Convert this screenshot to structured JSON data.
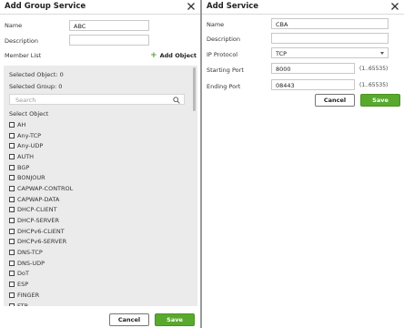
{
  "left_dialog": {
    "title": "Add Group Service",
    "name_label": "Name",
    "name_value": "ABC",
    "description_label": "Description",
    "description_value": "",
    "member_list_label": "Member List",
    "add_object_label": "Add Object",
    "selected_object": "Selected Object: 0",
    "selected_group": "Selected Group: 0",
    "search_placeholder": "Search",
    "select_object_header": "Select Object",
    "objects": [
      "AH",
      "Any-TCP",
      "Any-UDP",
      "AUTH",
      "BGP",
      "BONJOUR",
      "CAPWAP-CONTROL",
      "CAPWAP-DATA",
      "DHCP-CLIENT",
      "DHCP-SERVER",
      "DHCPv6-CLIENT",
      "DHCPv6-SERVER",
      "DNS-TCP",
      "DNS-UDP",
      "DoT",
      "ESP",
      "FINGER",
      "FTP"
    ],
    "cancel_label": "Cancel",
    "save_label": "Save"
  },
  "right_dialog": {
    "title": "Add Service",
    "name_label": "Name",
    "name_value": "CBA",
    "description_label": "Description",
    "description_value": "",
    "ip_protocol_label": "IP Protocol",
    "ip_protocol_value": "TCP",
    "starting_port_label": "Starting Port",
    "starting_port_value": "8000",
    "starting_port_range": "(1..65535)",
    "ending_port_label": "Ending Port",
    "ending_port_value": "08443",
    "ending_port_range": "(1..65535)",
    "cancel_label": "Cancel",
    "save_label": "Save"
  },
  "colors": {
    "accent_green": "#58a92d",
    "panel_gray": "#ebebeb",
    "backdrop": "#9a9a9a"
  }
}
